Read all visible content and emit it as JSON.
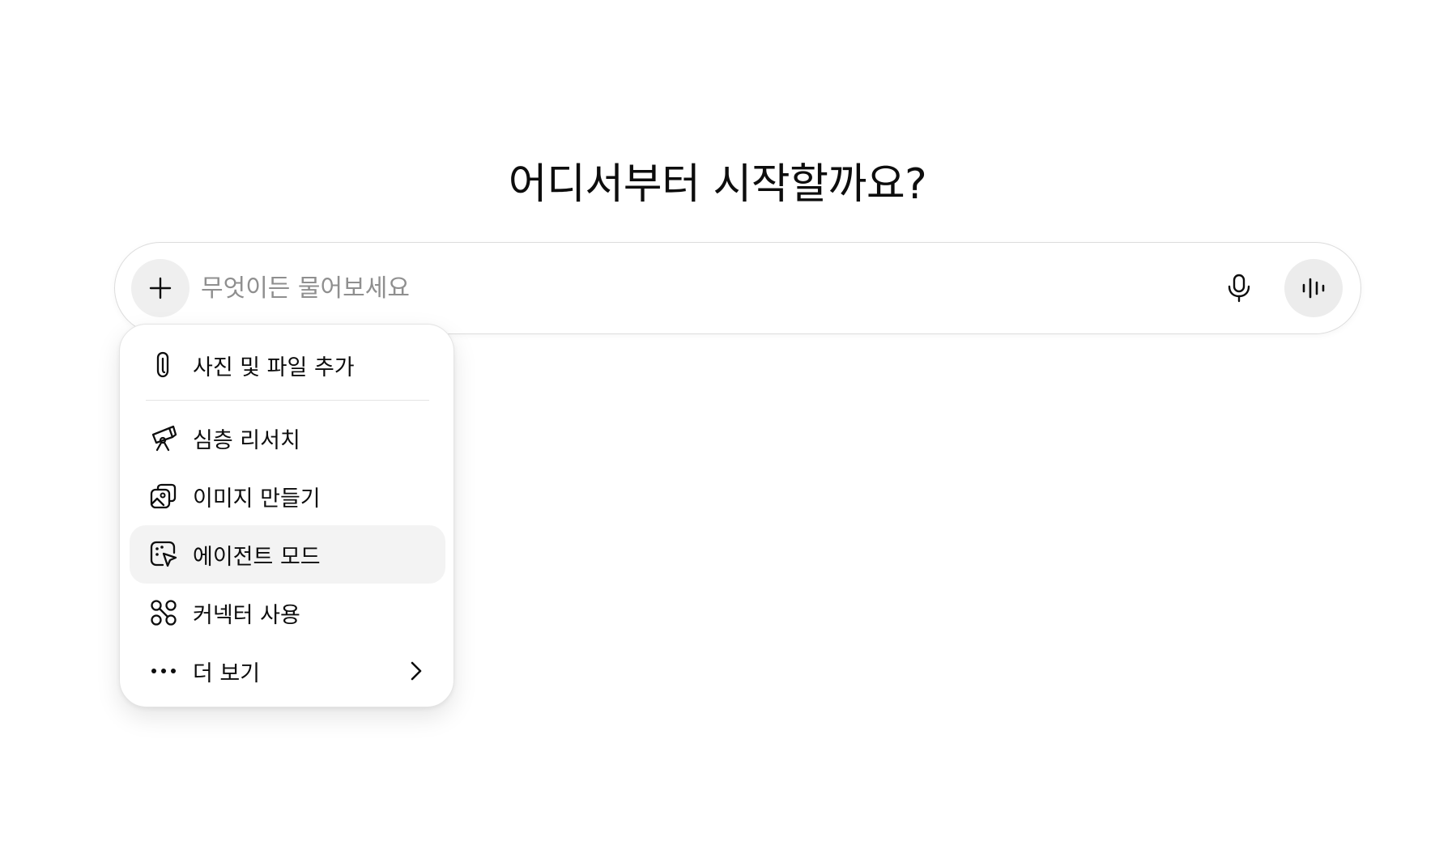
{
  "heading": "어디서부터 시작할까요?",
  "composer": {
    "placeholder": "무엇이든 물어보세요",
    "value": "",
    "plus_icon": "plus-icon",
    "mic_icon": "microphone-icon",
    "voice_icon": "voice-waveform-icon"
  },
  "menu": {
    "items": [
      {
        "label": "사진 및 파일 추가",
        "icon": "paperclip-icon"
      },
      {
        "label": "심층 리서치",
        "icon": "telescope-icon"
      },
      {
        "label": "이미지 만들기",
        "icon": "image-create-icon"
      },
      {
        "label": "에이전트 모드",
        "icon": "agent-cursor-icon",
        "highlighted": true
      },
      {
        "label": "커넥터 사용",
        "icon": "connectors-icon"
      },
      {
        "label": "더 보기",
        "icon": "more-dots-icon",
        "submenu_icon": "chevron-right-icon"
      }
    ]
  },
  "colors": {
    "text": "#0d0d0d",
    "placeholder": "#8f8f8f",
    "button_bg": "#efefef",
    "highlight_bg": "#f3f3f3",
    "border": "#dcdcdc"
  }
}
